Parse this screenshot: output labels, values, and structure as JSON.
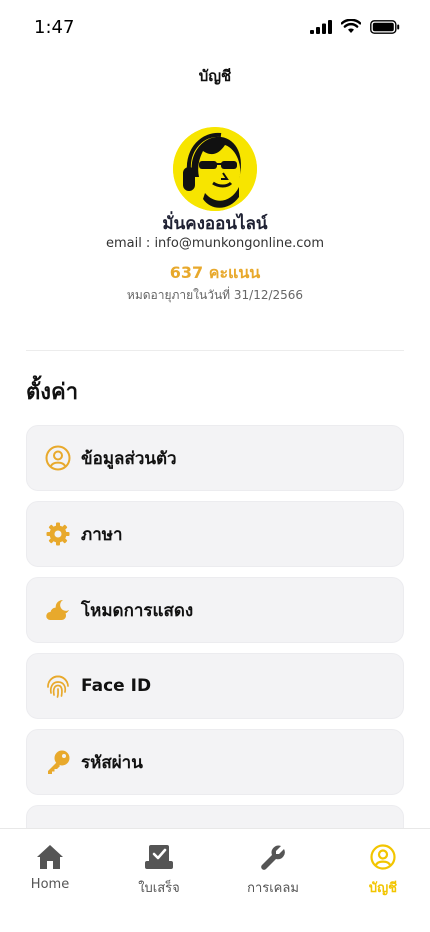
{
  "status_bar": {
    "time": "1:47"
  },
  "header": {
    "title": "บัญชี"
  },
  "profile": {
    "name": "มั่นคงออนไลน์",
    "email": "email : info@munkongonline.com",
    "points": "637 คะแนน",
    "expiry": "หมดอายุภายในวันที่ 31/12/2566"
  },
  "settings": {
    "title": "ตั้งค่า",
    "items": [
      {
        "label": "ข้อมูลส่วนตัว",
        "icon": "user-circle-icon"
      },
      {
        "label": "ภาษา",
        "icon": "gear-icon"
      },
      {
        "label": "โหมดการแสดง",
        "icon": "moon-cloud-icon"
      },
      {
        "label": "Face ID",
        "icon": "fingerprint-icon"
      },
      {
        "label": "รหัสผ่าน",
        "icon": "key-icon"
      }
    ]
  },
  "tabbar": {
    "items": [
      {
        "label": "Home",
        "icon": "home-icon"
      },
      {
        "label": "ใบเสร็จ",
        "icon": "receipt-check-icon"
      },
      {
        "label": "การเคลม",
        "icon": "wrench-icon"
      },
      {
        "label": "บัญชี",
        "icon": "user-circle-icon",
        "active": true
      }
    ]
  },
  "colors": {
    "accent": "#e8a92c",
    "active_tab": "#f2c500",
    "card_bg": "#f3f3f5"
  }
}
